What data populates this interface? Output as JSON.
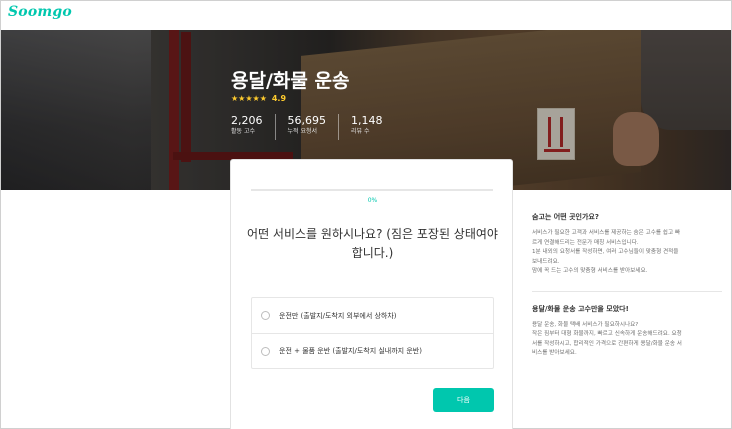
{
  "header": {
    "logo_text": "Soomgo"
  },
  "hero": {
    "title": "용달/화물 운송",
    "rating_stars": "★★★★★",
    "rating_value": "4.9",
    "stats": [
      {
        "value": "2,206",
        "label": "활동 고수"
      },
      {
        "value": "56,695",
        "label": "누적 요청서"
      },
      {
        "value": "1,148",
        "label": "리뷰 수"
      }
    ]
  },
  "form": {
    "progress_percent": 0,
    "progress_text": "0%",
    "question": "어떤 서비스를 원하시나요? (짐은 포장된 상태여야 합니다.)",
    "options": [
      {
        "label": "운전만 (출발지/도착지 외부에서 상하차)",
        "selected": false
      },
      {
        "label": "운전 + 물품 운반 (출발지/도착지 실내까지 운반)",
        "selected": false
      }
    ],
    "next_label": "다음"
  },
  "side": {
    "sections": [
      {
        "title": "숨고는 어떤 곳인가요?",
        "lines": [
          "서비스가 필요한 고객과 서비스를 제공하는 숨은 고수를 쉽고 빠",
          "르게 연결해드리는 전문가 매칭 서비스입니다.",
          "1분 내외의 요청서를 작성하면, 여러 고수님들이 맞춤형 견적을",
          "보내드려요.",
          "맘에 꼭 드는 고수의 맞춤형 서비스를 받아보세요."
        ]
      },
      {
        "title": "용달/화물 운송 고수만을 모았다!",
        "lines": [
          "용달 운송, 화물 택배 서비스가 필요하시나요?",
          "작은 짐부터 대형 화물까지, 빠르고 신속하게 운송해드려요. 요청",
          "서를 작성하시고, 합리적인 가격으로 간편하게 용달/화물 운송 서",
          "비스를 받아보세요."
        ]
      }
    ]
  },
  "colors": {
    "accent": "#00c7ae",
    "star": "#ffcc2e",
    "text": "#323232",
    "muted": "#6f6f6f"
  }
}
